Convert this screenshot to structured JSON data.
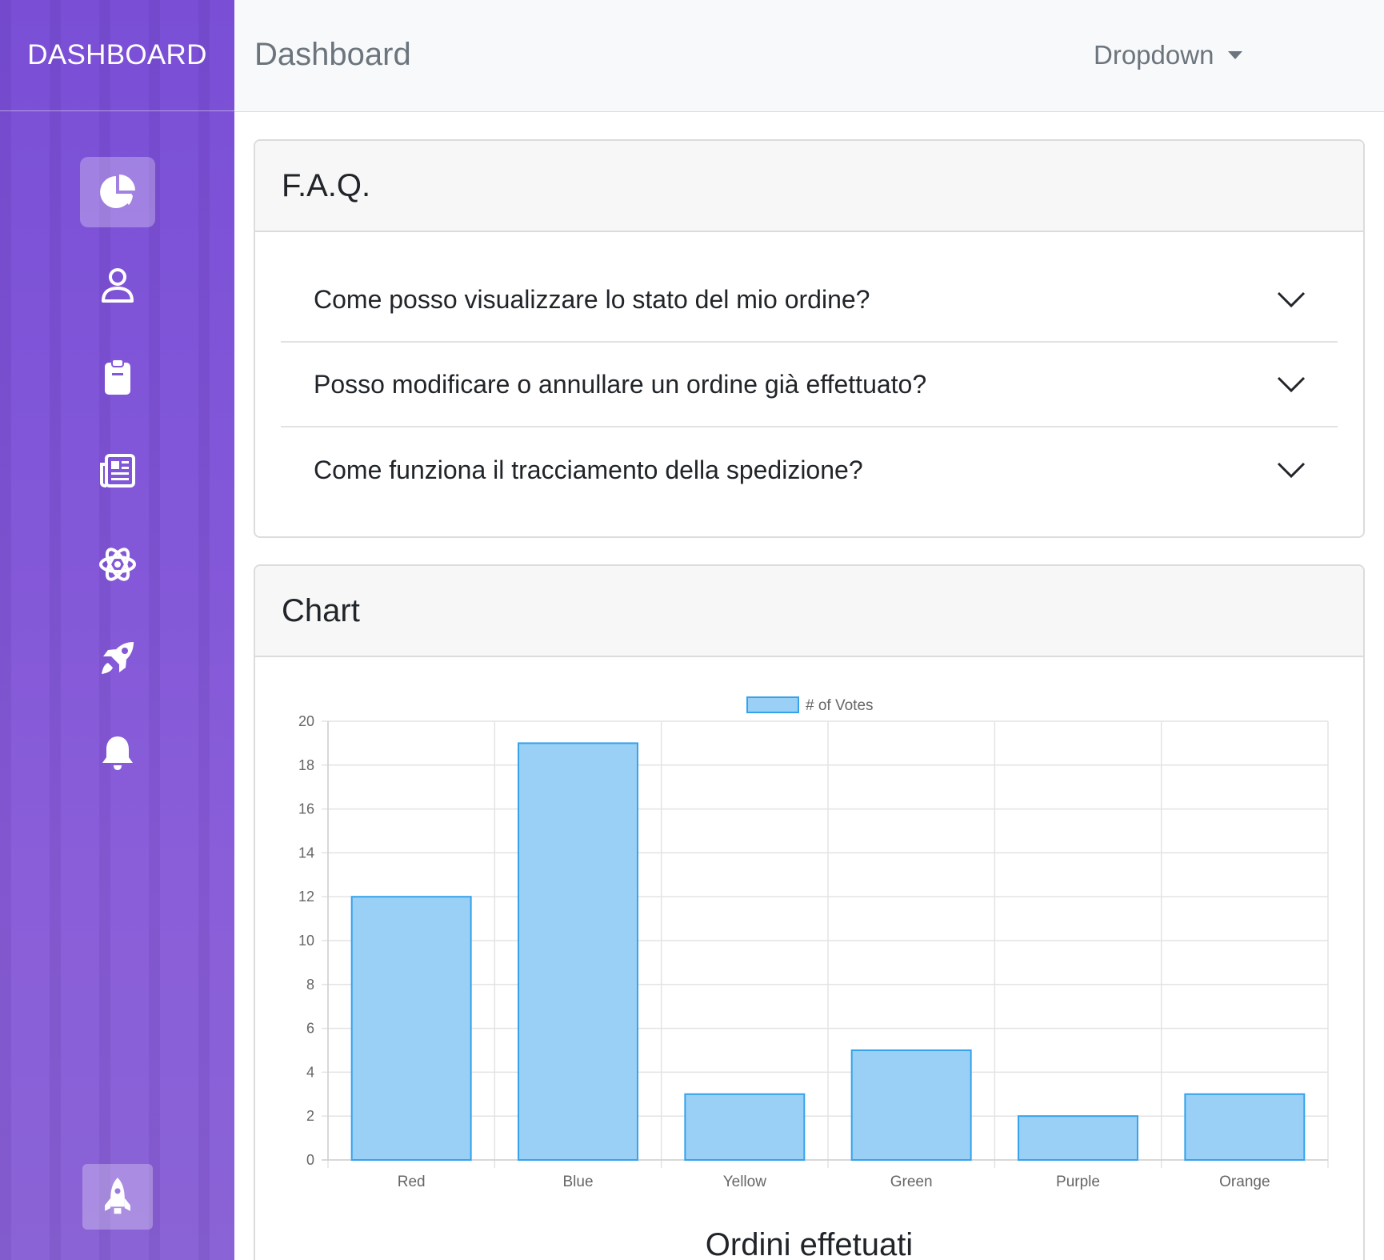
{
  "brand": "DASHBOARD",
  "header": {
    "title": "Dashboard",
    "dropdown_label": "Dropdown"
  },
  "sidebar": {
    "items": [
      {
        "icon": "pie-chart-icon",
        "active": true
      },
      {
        "icon": "user-icon",
        "active": false
      },
      {
        "icon": "clipboard-icon",
        "active": false
      },
      {
        "icon": "newspaper-icon",
        "active": false
      },
      {
        "icon": "atom-icon",
        "active": false
      },
      {
        "icon": "rocket-icon",
        "active": false
      },
      {
        "icon": "bell-icon",
        "active": false
      }
    ],
    "bottom_icon": "rocket-launch-icon"
  },
  "faq": {
    "title": "F.A.Q.",
    "items": [
      {
        "question": "Come posso visualizzare lo stato del mio ordine?"
      },
      {
        "question": "Posso modificare o annullare un ordine già effettuato?"
      },
      {
        "question": "Come funziona il tracciamento della spedizione?"
      }
    ]
  },
  "chart_card": {
    "title": "Chart",
    "caption": "Ordini effetuati"
  },
  "chart_data": {
    "type": "bar",
    "categories": [
      "Red",
      "Blue",
      "Yellow",
      "Green",
      "Purple",
      "Orange"
    ],
    "series": [
      {
        "name": "# of Votes",
        "values": [
          12,
          19,
          3,
          5,
          2,
          3
        ]
      }
    ],
    "ylim": [
      0,
      20
    ],
    "yticks": [
      0,
      2,
      4,
      6,
      8,
      10,
      12,
      14,
      16,
      18,
      20
    ],
    "grid": true,
    "legend": "top",
    "bar_fill": "#9ad0f5",
    "bar_stroke": "#36a2eb"
  }
}
